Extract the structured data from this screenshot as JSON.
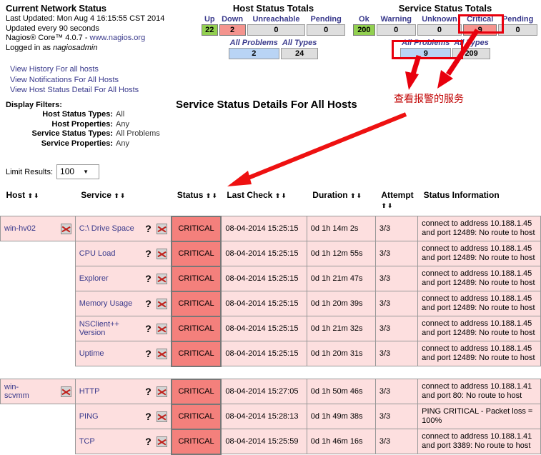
{
  "header": {
    "title": "Current Network Status",
    "last_updated": "Last Updated: Mon Aug 4 16:15:55 CST 2014",
    "update_interval": "Updated every 90 seconds",
    "version_prefix": "Nagios® Core™ 4.0.7 - ",
    "version_link": "www.nagios.org",
    "logged_in_prefix": "Logged in as ",
    "logged_in_user": "nagiosadmin"
  },
  "view_links": [
    "View History For all hosts",
    "View Notifications For All Hosts",
    "View Host Status Detail For All Hosts"
  ],
  "filters": {
    "heading": "Display Filters:",
    "rows": [
      {
        "key": "Host Status Types:",
        "value": "All"
      },
      {
        "key": "Host Properties:",
        "value": "Any"
      },
      {
        "key": "Service Status Types:",
        "value": "All Problems"
      },
      {
        "key": "Service Properties:",
        "value": "Any"
      }
    ],
    "limit_label": "Limit Results:",
    "limit_value": "100",
    "caret_icon": "chevron-down-icon"
  },
  "host_totals": {
    "title": "Host Status Totals",
    "columns": [
      "Up",
      "Down",
      "Unreachable",
      "Pending"
    ],
    "values": [
      "22",
      "2",
      "0",
      "0"
    ],
    "sub_columns": [
      "All Problems",
      "All Types"
    ],
    "sub_values": [
      "2",
      "24"
    ]
  },
  "service_totals": {
    "title": "Service Status Totals",
    "columns": [
      "Ok",
      "Warning",
      "Unknown",
      "Critical",
      "Pending"
    ],
    "values": [
      "200",
      "0",
      "0",
      "9",
      "0"
    ],
    "sub_columns": [
      "All Problems",
      "All Types"
    ],
    "sub_values": [
      "9",
      "209"
    ]
  },
  "page_title": "Service Status Details For All Hosts",
  "annotation": {
    "text": "查看报警的服务",
    "color": "#c00000",
    "box_color": "#e8000d"
  },
  "table": {
    "columns": [
      {
        "label": "Host",
        "sort": "⬆⬇"
      },
      {
        "label": "Service",
        "sort": "⬆⬇"
      },
      {
        "label": "Status",
        "sort": "⬆⬇"
      },
      {
        "label": "Last Check",
        "sort": "⬆⬇"
      },
      {
        "label": "Duration",
        "sort": "⬆⬇"
      },
      {
        "label": "Attempt",
        "sort": "⬆⬇"
      },
      {
        "label": "Status Information",
        "sort": ""
      }
    ],
    "groups": [
      {
        "host": "win-hv02",
        "host_icon": "notifications-disabled-icon",
        "rows": [
          {
            "service": "C:\\ Drive Space",
            "status": "CRITICAL",
            "last_check": "08-04-2014 15:25:15",
            "duration": "0d 1h 14m 2s",
            "attempt": "3/3",
            "info": "connect to address 10.188.1.45 and port 12489: No route to host"
          },
          {
            "service": "CPU Load",
            "status": "CRITICAL",
            "last_check": "08-04-2014 15:25:15",
            "duration": "0d 1h 12m 55s",
            "attempt": "3/3",
            "info": "connect to address 10.188.1.45 and port 12489: No route to host"
          },
          {
            "service": "Explorer",
            "status": "CRITICAL",
            "last_check": "08-04-2014 15:25:15",
            "duration": "0d 1h 21m 47s",
            "attempt": "3/3",
            "info": "connect to address 10.188.1.45 and port 12489: No route to host"
          },
          {
            "service": "Memory Usage",
            "status": "CRITICAL",
            "last_check": "08-04-2014 15:25:15",
            "duration": "0d 1h 20m 39s",
            "attempt": "3/3",
            "info": "connect to address 10.188.1.45 and port 12489: No route to host"
          },
          {
            "service": "NSClient++ Version",
            "status": "CRITICAL",
            "last_check": "08-04-2014 15:25:15",
            "duration": "0d 1h 21m 32s",
            "attempt": "3/3",
            "info": "connect to address 10.188.1.45 and port 12489: No route to host"
          },
          {
            "service": "Uptime",
            "status": "CRITICAL",
            "last_check": "08-04-2014 15:25:15",
            "duration": "0d 1h 20m 31s",
            "attempt": "3/3",
            "info": "connect to address 10.188.1.45 and port 12489: No route to host"
          }
        ]
      },
      {
        "host": "win-scvmm",
        "host_icon": "notifications-disabled-icon",
        "rows": [
          {
            "service": "HTTP",
            "status": "CRITICAL",
            "last_check": "08-04-2014 15:27:05",
            "duration": "0d 1h 50m 46s",
            "attempt": "3/3",
            "info": "connect to address 10.188.1.41 and port 80: No route to host"
          },
          {
            "service": "PING",
            "status": "CRITICAL",
            "last_check": "08-04-2014 15:28:13",
            "duration": "0d 1h 49m 38s",
            "attempt": "3/3",
            "info": "PING CRITICAL - Packet loss = 100%"
          },
          {
            "service": "TCP",
            "status": "CRITICAL",
            "last_check": "08-04-2014 15:25:59",
            "duration": "0d 1h 46m 16s",
            "attempt": "3/3",
            "info": "connect to address 10.188.1.41 and port 3389: No route to host"
          }
        ]
      }
    ],
    "help_icon": "?",
    "row_icon": "notifications-disabled-icon"
  },
  "colors": {
    "ok_green": "#92d050",
    "critical_red": "#f4807c",
    "bad_pink": "#f4948e",
    "row_pink": "#fddfdf",
    "problems_blue": "#b9d4f5",
    "link_blue": "#3a3a8c"
  }
}
